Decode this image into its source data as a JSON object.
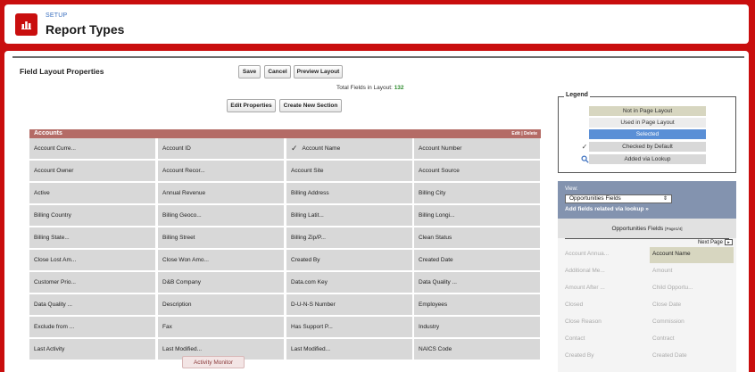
{
  "header": {
    "eyebrow": "SETUP",
    "title": "Report Types"
  },
  "main": {
    "section_title": "Field Layout Properties",
    "buttons": {
      "save": "Save",
      "cancel": "Cancel",
      "preview": "Preview Layout",
      "edit_properties": "Edit Properties",
      "create_section": "Create New Section"
    },
    "total_label": "Total Fields in Layout:",
    "total_value": "132"
  },
  "legend": {
    "title": "Legend",
    "items": [
      {
        "label": "Not in Page Layout",
        "color": "#d7d6c0"
      },
      {
        "label": "Used in Page Layout",
        "color": "#ececec"
      },
      {
        "label": "Selected",
        "color": "#5a8fd6"
      },
      {
        "label": "Checked by Default",
        "color": "#d8d8d8",
        "icon": "checkmark-icon"
      },
      {
        "label": "Added via Lookup",
        "color": "#d8d8d8",
        "icon": "lookup-icon"
      }
    ]
  },
  "accounts": {
    "title": "Accounts",
    "actions": "Edit | Delete",
    "fields": [
      [
        "Account Curre...",
        "Account ID",
        "Account Name",
        "Account Number"
      ],
      [
        "Account Owner",
        "Account Recor...",
        "Account Site",
        "Account Source"
      ],
      [
        "Active",
        "Annual Revenue",
        "Billing Address",
        "Billing City"
      ],
      [
        "Billing Country",
        "Billing Geoco...",
        "Billing Latit...",
        "Billing Longi..."
      ],
      [
        "Billing State...",
        "Billing Street",
        "Billing Zip/P...",
        "Clean Status"
      ],
      [
        "Close Lost Am...",
        "Close Won Amo...",
        "Created By",
        "Created Date"
      ],
      [
        "Customer Prio...",
        "D&B Company",
        "Data.com Key",
        "Data Quality ..."
      ],
      [
        "Data Quality ...",
        "Description",
        "D-U-N-S Number",
        "Employees"
      ],
      [
        "Exclude from ...",
        "Fax",
        "Has Support P...",
        "Industry"
      ],
      [
        "Last Activity",
        "Last Modified...",
        "Last Modified...",
        "NAICS Code"
      ]
    ],
    "checked_field": "Account Name"
  },
  "activity_monitor": "Activity Monitor",
  "panel": {
    "view_label": "View:",
    "view_value": "Opportunities Fields",
    "add_lookup": "Add fields related via lookup »",
    "fields_title": "Opportunities Fields",
    "page_info": "[Page1/4]",
    "next_page": "Next Page",
    "rows": [
      [
        "Account Annua...",
        "Account Name"
      ],
      [
        "Additional Me...",
        "Amount"
      ],
      [
        "Amount After ...",
        "Child Opportu..."
      ],
      [
        "Closed",
        "Close Date"
      ],
      [
        "Close Reason",
        "Commission"
      ],
      [
        "Contact",
        "Contract"
      ],
      [
        "Created By",
        "Created Date"
      ]
    ],
    "selected_field": "Account Name"
  }
}
